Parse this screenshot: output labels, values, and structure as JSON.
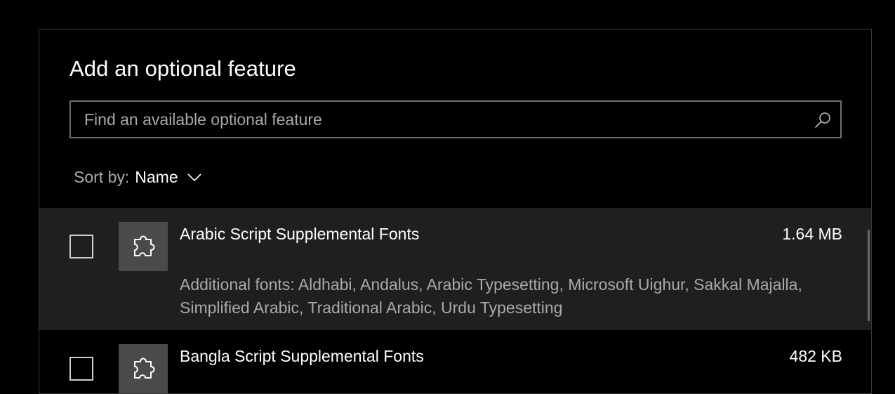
{
  "dialog": {
    "title": "Add an optional feature",
    "search": {
      "placeholder": "Find an available optional feature",
      "value": "",
      "icon": "search-icon"
    },
    "sort": {
      "label": "Sort by:",
      "value": "Name",
      "icon": "chevron-down-icon"
    },
    "features": [
      {
        "name": "Arabic Script Supplemental Fonts",
        "size": "1.64 MB",
        "description": "Additional fonts: Aldhabi, Andalus, Arabic Typesetting, Microsoft Uighur, Sakkal Majalla, Simplified Arabic, Traditional Arabic, Urdu Typesetting",
        "checked": false,
        "selected": true,
        "icon": "puzzle-piece-icon"
      },
      {
        "name": "Bangla Script Supplemental Fonts",
        "size": "482 KB",
        "checked": false,
        "selected": false,
        "icon": "puzzle-piece-icon"
      }
    ]
  },
  "colors": {
    "background": "#000000",
    "selected_row": "#1f1f1f",
    "icon_tile": "#4c4a48",
    "secondary_text": "#a9a9a9",
    "primary_text": "#ffffff",
    "border": "#6e6e6e"
  }
}
